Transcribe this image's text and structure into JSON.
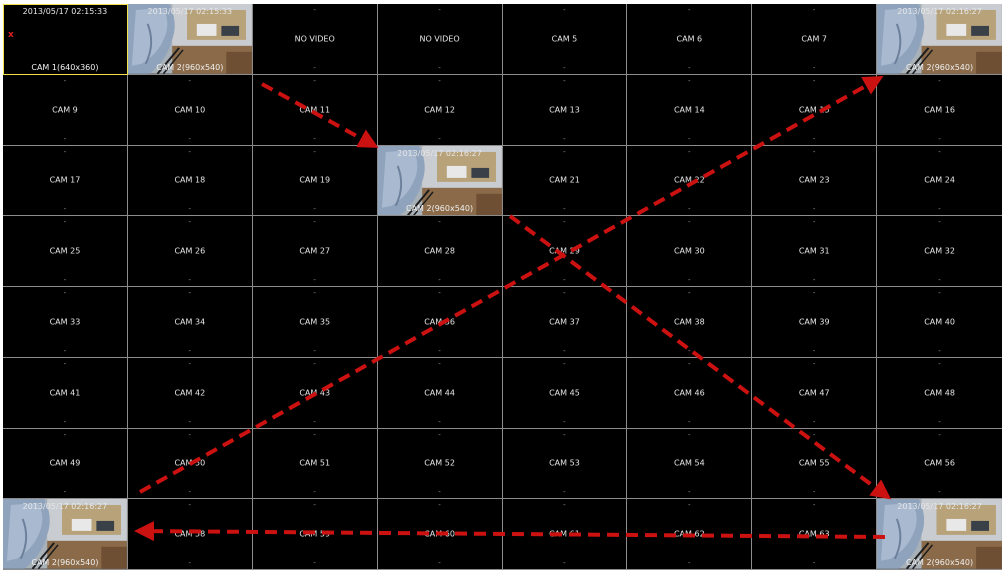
{
  "wall": {
    "tiles": [
      {
        "index": 1,
        "kind": "live-blank",
        "timestamp": "2013/05/17 02:15:33",
        "caption": "CAM 1(640x360)",
        "selected": true,
        "motion_mark": "х"
      },
      {
        "index": 2,
        "kind": "video",
        "timestamp": "2013/05/17 02:15:33",
        "caption": "CAM 2(960x540)"
      },
      {
        "index": 3,
        "kind": "label",
        "label": "NO VIDEO"
      },
      {
        "index": 4,
        "kind": "label",
        "label": "NO VIDEO"
      },
      {
        "index": 5,
        "kind": "label",
        "label": "CAM 5"
      },
      {
        "index": 6,
        "kind": "label",
        "label": "CAM 6"
      },
      {
        "index": 7,
        "kind": "label",
        "label": "CAM 7"
      },
      {
        "index": 8,
        "kind": "video",
        "timestamp": "2013/05/17 02:16:27",
        "caption": "CAM 2(960x540)"
      },
      {
        "index": 9,
        "kind": "label",
        "label": "CAM 9"
      },
      {
        "index": 10,
        "kind": "label",
        "label": "CAM 10"
      },
      {
        "index": 11,
        "kind": "label",
        "label": "CAM 11"
      },
      {
        "index": 12,
        "kind": "label",
        "label": "CAM 12"
      },
      {
        "index": 13,
        "kind": "label",
        "label": "CAM 13"
      },
      {
        "index": 14,
        "kind": "label",
        "label": "CAM 14"
      },
      {
        "index": 15,
        "kind": "label",
        "label": "CAM 15"
      },
      {
        "index": 16,
        "kind": "label",
        "label": "CAM 16"
      },
      {
        "index": 17,
        "kind": "label",
        "label": "CAM 17"
      },
      {
        "index": 18,
        "kind": "label",
        "label": "CAM 18"
      },
      {
        "index": 19,
        "kind": "label",
        "label": "CAM 19"
      },
      {
        "index": 20,
        "kind": "video",
        "timestamp": "2013/05/17 02:16:27",
        "caption": "CAM 2(960x540)"
      },
      {
        "index": 21,
        "kind": "label",
        "label": "CAM 21"
      },
      {
        "index": 22,
        "kind": "label",
        "label": "CAM 22"
      },
      {
        "index": 23,
        "kind": "label",
        "label": "CAM 23"
      },
      {
        "index": 24,
        "kind": "label",
        "label": "CAM 24"
      },
      {
        "index": 25,
        "kind": "label",
        "label": "CAM 25"
      },
      {
        "index": 26,
        "kind": "label",
        "label": "CAM 26"
      },
      {
        "index": 27,
        "kind": "label",
        "label": "CAM 27"
      },
      {
        "index": 28,
        "kind": "label",
        "label": "CAM 28"
      },
      {
        "index": 29,
        "kind": "label",
        "label": "CAM 29"
      },
      {
        "index": 30,
        "kind": "label",
        "label": "CAM 30"
      },
      {
        "index": 31,
        "kind": "label",
        "label": "CAM 31"
      },
      {
        "index": 32,
        "kind": "label",
        "label": "CAM 32"
      },
      {
        "index": 33,
        "kind": "label",
        "label": "CAM 33"
      },
      {
        "index": 34,
        "kind": "label",
        "label": "CAM 34"
      },
      {
        "index": 35,
        "kind": "label",
        "label": "CAM 35"
      },
      {
        "index": 36,
        "kind": "label",
        "label": "CAM 36"
      },
      {
        "index": 37,
        "kind": "label",
        "label": "CAM 37"
      },
      {
        "index": 38,
        "kind": "label",
        "label": "CAM 38"
      },
      {
        "index": 39,
        "kind": "label",
        "label": "CAM 39"
      },
      {
        "index": 40,
        "kind": "label",
        "label": "CAM 40"
      },
      {
        "index": 41,
        "kind": "label",
        "label": "CAM 41"
      },
      {
        "index": 42,
        "kind": "label",
        "label": "CAM 42"
      },
      {
        "index": 43,
        "kind": "label",
        "label": "CAM 43"
      },
      {
        "index": 44,
        "kind": "label",
        "label": "CAM 44"
      },
      {
        "index": 45,
        "kind": "label",
        "label": "CAM 45"
      },
      {
        "index": 46,
        "kind": "label",
        "label": "CAM 46"
      },
      {
        "index": 47,
        "kind": "label",
        "label": "CAM 47"
      },
      {
        "index": 48,
        "kind": "label",
        "label": "CAM 48"
      },
      {
        "index": 49,
        "kind": "label",
        "label": "CAM 49"
      },
      {
        "index": 50,
        "kind": "label",
        "label": "CAM 50"
      },
      {
        "index": 51,
        "kind": "label",
        "label": "CAM 51"
      },
      {
        "index": 52,
        "kind": "label",
        "label": "CAM 52"
      },
      {
        "index": 53,
        "kind": "label",
        "label": "CAM 53"
      },
      {
        "index": 54,
        "kind": "label",
        "label": "CAM 54"
      },
      {
        "index": 55,
        "kind": "label",
        "label": "CAM 55"
      },
      {
        "index": 56,
        "kind": "label",
        "label": "CAM 56"
      },
      {
        "index": 57,
        "kind": "video",
        "timestamp": "2013/05/17 02:16:27",
        "caption": "CAM 2(960x540)"
      },
      {
        "index": 58,
        "kind": "label",
        "label": "CAM 58"
      },
      {
        "index": 59,
        "kind": "label",
        "label": "CAM 59"
      },
      {
        "index": 60,
        "kind": "label",
        "label": "CAM 60"
      },
      {
        "index": 61,
        "kind": "label",
        "label": "CAM 61"
      },
      {
        "index": 62,
        "kind": "label",
        "label": "CAM 62"
      },
      {
        "index": 63,
        "kind": "label",
        "label": "CAM 63"
      },
      {
        "index": 64,
        "kind": "video",
        "timestamp": "2013/05/17 02:16:27",
        "caption": "CAM 2(960x540)"
      }
    ],
    "placeholder_mark": "-"
  },
  "overlay": {
    "arrow_color": "#cc1111",
    "arrows": [
      {
        "name": "arrow-tile2-to-tile20",
        "from": 2,
        "to": 20
      },
      {
        "name": "arrow-tile20-to-tile64",
        "from": 20,
        "to": 64
      },
      {
        "name": "arrow-tile57-to-tile8",
        "from": 57,
        "to": 8
      },
      {
        "name": "arrow-tile64-to-tile57",
        "from": 64,
        "to": 57
      }
    ]
  },
  "colors": {
    "grid_line": "#8c8c8c",
    "selected_border": "#f2e04a",
    "tile_bg": "#000000",
    "label_text": "#e6e6e6"
  }
}
